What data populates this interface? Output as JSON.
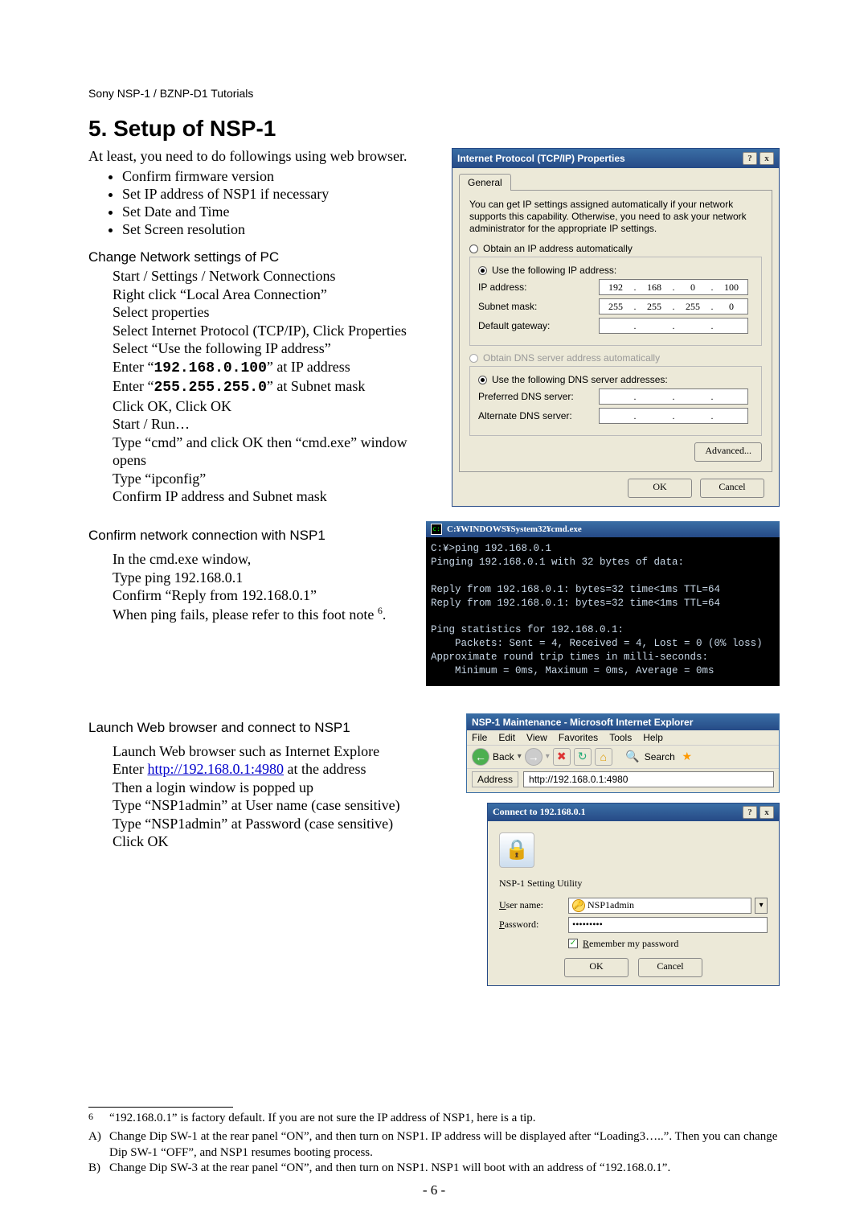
{
  "header": "Sony NSP-1 / BZNP-D1 Tutorials",
  "section_title": "5.  Setup of NSP-1",
  "intro": "At least, you need to do followings using web browser.",
  "bullets": [
    "Confirm firmware version",
    "Set IP address of NSP1 if necessary",
    "Set Date and Time",
    "Set Screen resolution"
  ],
  "net_head": "Change Network settings of PC",
  "net_steps": {
    "s1": "Start / Settings / Network Connections",
    "s2": "Right click “Local Area Connection”",
    "s3": "Select properties",
    "s4": "Select Internet Protocol (TCP/IP), Click Properties",
    "s5": "Select “Use the following IP address”",
    "s6a": "Enter “",
    "s6b": "192.168.0.100",
    "s6c": "” at IP address",
    "s7a": "Enter “",
    "s7b": "255.255.255.0",
    "s7c": "” at Subnet mask",
    "s8": "Click OK, Click OK",
    "s9": "Start / Run…",
    "s10": "Type “cmd” and click OK then “cmd.exe” window opens",
    "s11": "Type “ipconfig”",
    "s12": "Confirm IP address and Subnet mask"
  },
  "ping_head": "Confirm network connection with NSP1",
  "ping_steps": {
    "s1": "In the cmd.exe window,",
    "s2": "Type ping 192.168.0.1",
    "s3": "Confirm “Reply from 192.168.0.1”",
    "s4a": "When ping fails, please refer to this foot note ",
    "s4sup": "6",
    "s4b": "."
  },
  "web_head": "Launch Web browser and connect to NSP1",
  "web_steps": {
    "s1": "Launch Web browser such as Internet Explore",
    "s2a": "Enter ",
    "s2link": "http://192.168.0.1:4980",
    "s2b": " at the address",
    "s3": "Then a login window is popped up",
    "s4": "Type “NSP1admin” at User name (case sensitive)",
    "s5": "Type “NSP1admin” at Password (case sensitive)",
    "s6": "Click OK"
  },
  "tcpip": {
    "title": "Internet Protocol (TCP/IP) Properties",
    "tab": "General",
    "desc": "You can get IP settings assigned automatically if your network supports this capability. Otherwise, you need to ask your network administrator for the appropriate IP settings.",
    "r1": "Obtain an IP address automatically",
    "r2": "Use the following IP address:",
    "f_ip": "IP address:",
    "f_subnet": "Subnet mask:",
    "f_gw": "Default gateway:",
    "ip": [
      "192",
      "168",
      "0",
      "100"
    ],
    "subnet": [
      "255",
      "255",
      "255",
      "0"
    ],
    "r3": "Obtain DNS server address automatically",
    "r4": "Use the following DNS server addresses:",
    "f_dns1": "Preferred DNS server:",
    "f_dns2": "Alternate DNS server:",
    "advanced": "Advanced...",
    "ok": "OK",
    "cancel": "Cancel",
    "help": "?",
    "close": "x"
  },
  "cmd": {
    "title": "C:¥WINDOWS¥System32¥cmd.exe",
    "body": "C:¥>ping 192.168.0.1\nPinging 192.168.0.1 with 32 bytes of data:\n\nReply from 192.168.0.1: bytes=32 time<1ms TTL=64\nReply from 192.168.0.1: bytes=32 time<1ms TTL=64\n\nPing statistics for 192.168.0.1:\n    Packets: Sent = 4, Received = 4, Lost = 0 (0% loss)\nApproximate round trip times in milli-seconds:\n    Minimum = 0ms, Maximum = 0ms, Average = 0ms"
  },
  "ie": {
    "title": "NSP-1 Maintenance - Microsoft Internet Explorer",
    "menu": [
      "File",
      "Edit",
      "View",
      "Favorites",
      "Tools",
      "Help"
    ],
    "back": "Back",
    "search": "Search",
    "addr_label": "Address",
    "addr_value": "http://192.168.0.1:4980"
  },
  "login": {
    "title": "Connect to 192.168.0.1",
    "app": "NSP-1 Setting Utility",
    "u_label": "User name:",
    "u_value": "NSP1admin",
    "p_label": "Password:",
    "p_value": "•••••••••",
    "remember": "Remember my password",
    "ok": "OK",
    "cancel": "Cancel",
    "help": "?",
    "close": "x"
  },
  "footnotes": {
    "n6": "“192.168.0.1” is factory default. If you are not sure the IP address of NSP1, here is a tip.",
    "a": "Change Dip SW-1 at the rear panel “ON”, and then turn on NSP1. IP address will be displayed after “Loading3…..”. Then you can change Dip SW-1 “OFF”, and NSP1 resumes booting process.",
    "b": "Change Dip SW-3 at the rear panel “ON”, and then turn on NSP1. NSP1 will boot with an address of “192.168.0.1”."
  },
  "page_num": "- 6 -"
}
